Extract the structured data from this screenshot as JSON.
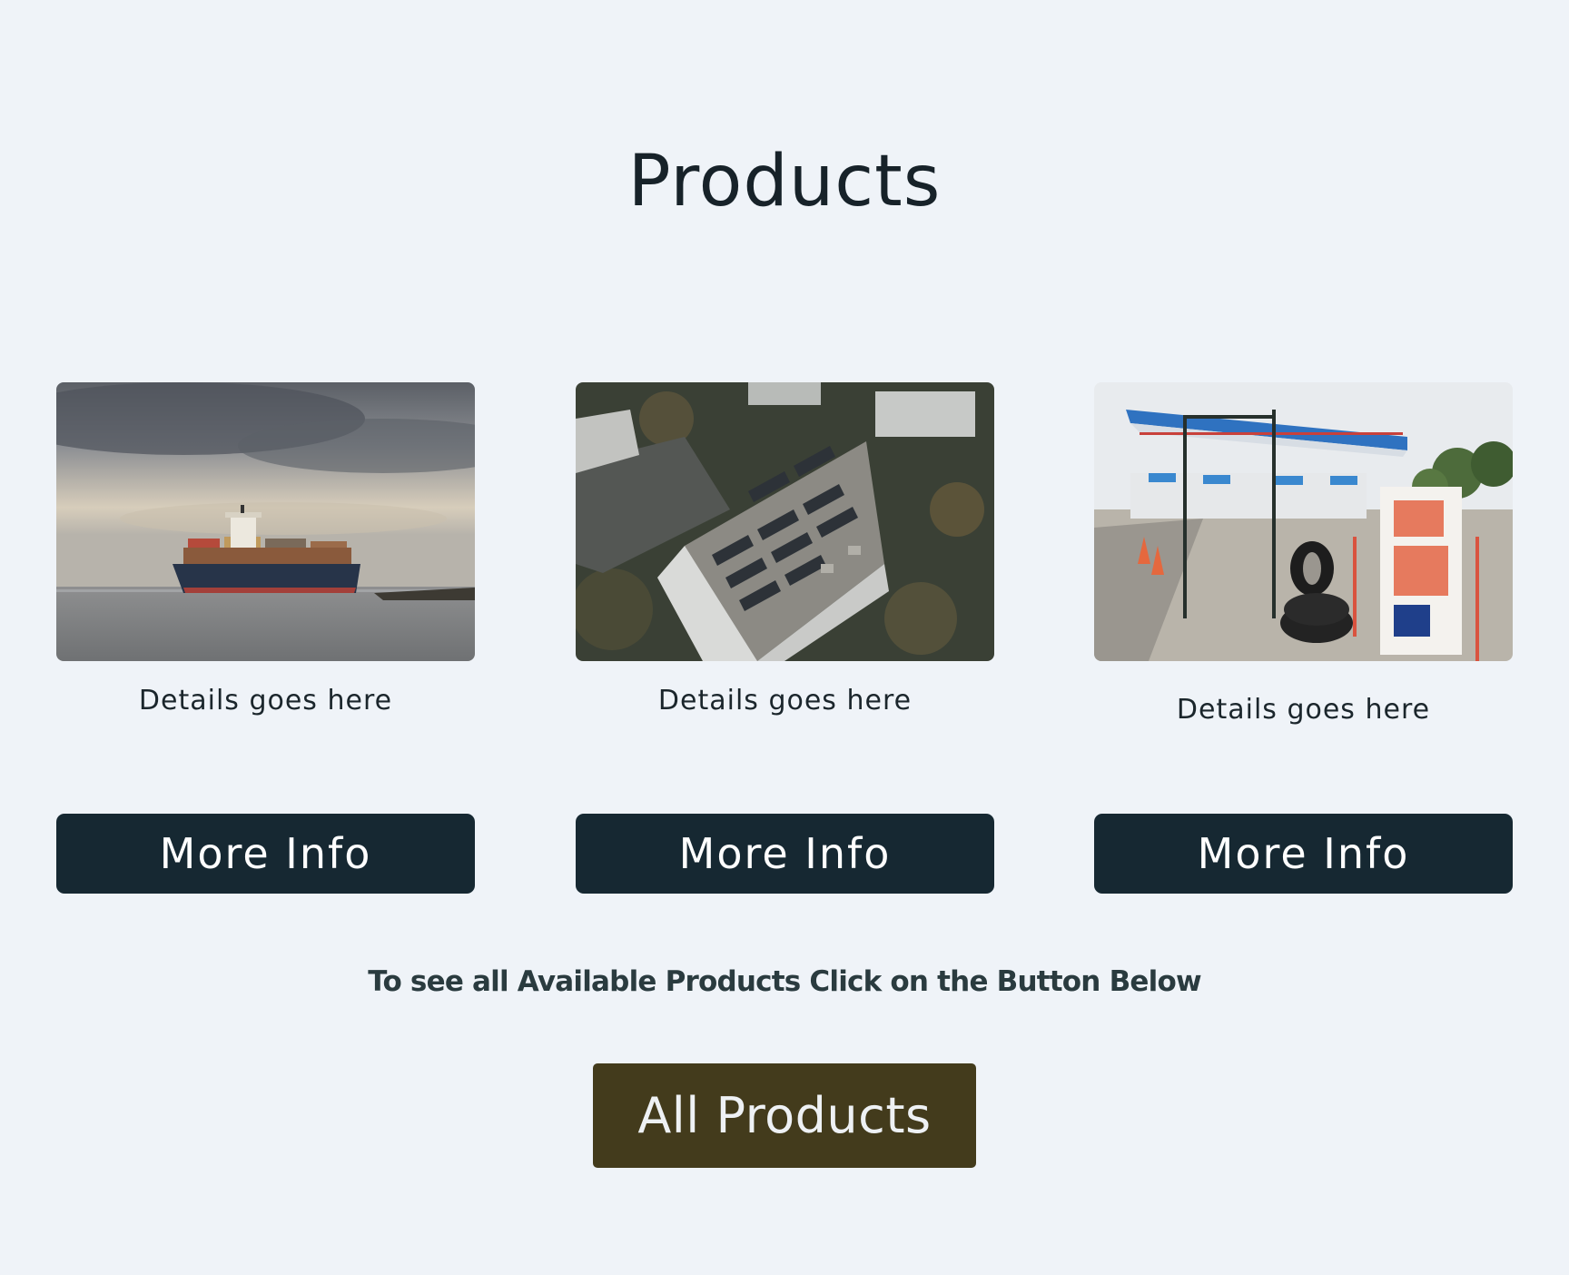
{
  "section": {
    "title": "Products"
  },
  "cards": [
    {
      "image_icon": "container-ship-photo",
      "details": "Details goes here",
      "button_label": "More Info"
    },
    {
      "image_icon": "solar-roof-building-photo",
      "details": "Details goes here",
      "button_label": "More Info"
    },
    {
      "image_icon": "gas-station-photo",
      "details": "Details goes here",
      "button_label": "More Info"
    }
  ],
  "cta": {
    "text": "To see all Available Products Click on the Button Below",
    "button_label": "All Products"
  },
  "colors": {
    "background": "#eff3f8",
    "button_dark": "#162832",
    "button_brand": "#433b1c"
  }
}
